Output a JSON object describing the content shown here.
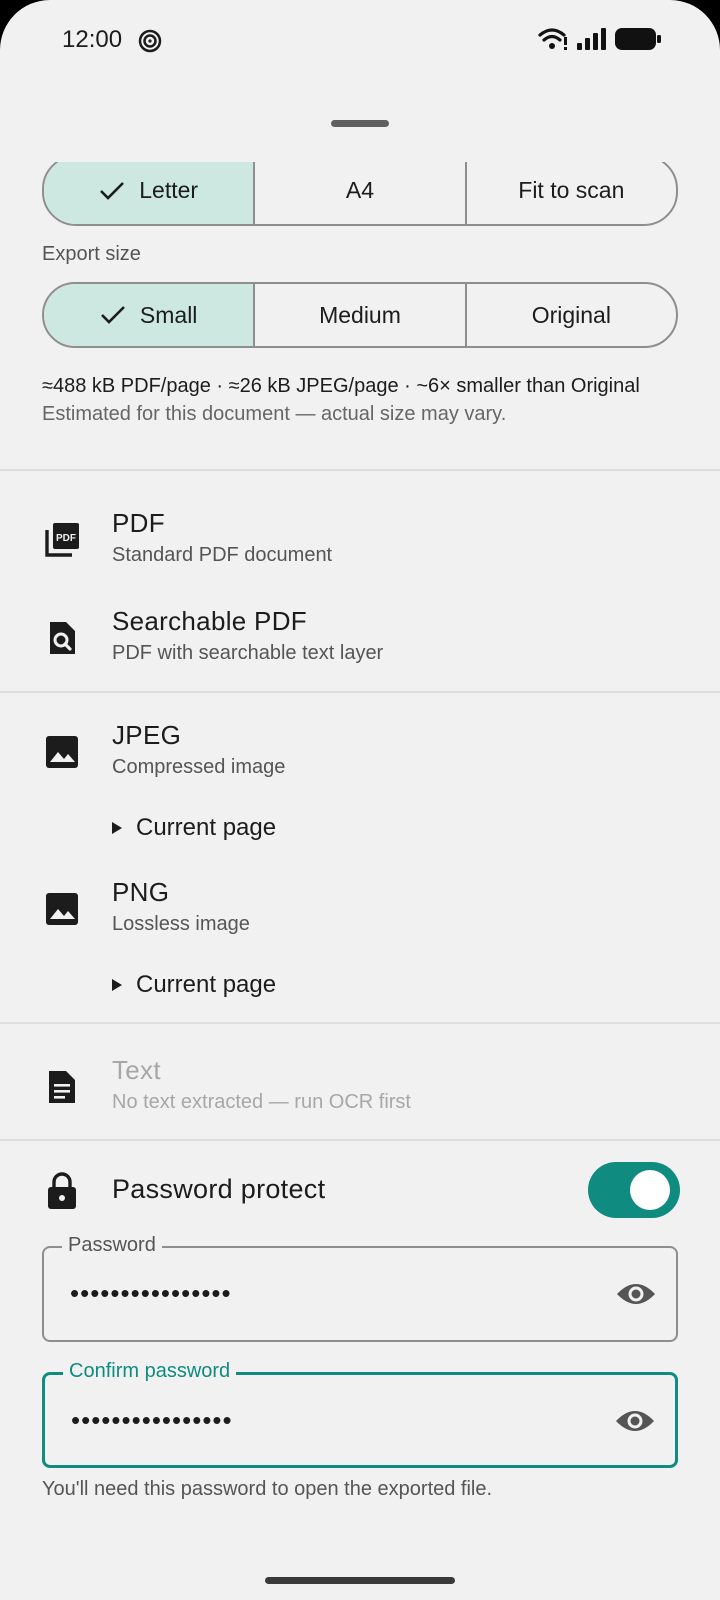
{
  "status": {
    "time": "12:00"
  },
  "page_size": {
    "options": [
      {
        "label": "Letter",
        "selected": true
      },
      {
        "label": "A4",
        "selected": false
      },
      {
        "label": "Fit to scan",
        "selected": false
      }
    ]
  },
  "export_size": {
    "label": "Export size",
    "options": [
      {
        "label": "Small",
        "selected": true
      },
      {
        "label": "Medium",
        "selected": false
      },
      {
        "label": "Original",
        "selected": false
      }
    ],
    "estimate": "≈488 kB PDF/page · ≈26 kB JPEG/page · ~6× smaller than Original",
    "note": "Estimated for this document — actual size may vary."
  },
  "formats": [
    {
      "title": "PDF",
      "subtitle": "Standard PDF document",
      "icon": "pdf-icon"
    },
    {
      "title": "Searchable PDF",
      "subtitle": "PDF with searchable text layer",
      "icon": "search-document-icon"
    },
    {
      "title": "JPEG",
      "subtitle": "Compressed image",
      "icon": "image-icon",
      "scope": "Current page"
    },
    {
      "title": "PNG",
      "subtitle": "Lossless image",
      "icon": "image-icon",
      "scope": "Current page"
    },
    {
      "title": "Text",
      "subtitle": "No text extracted — run OCR first",
      "icon": "document-text-icon",
      "disabled": true
    }
  ],
  "password": {
    "toggle_label": "Password protect",
    "enabled": true,
    "password_label": "Password",
    "password_value": "••••••••••••••••",
    "confirm_label": "Confirm password",
    "confirm_value": "••••••••••••••••",
    "hint": "You'll need this password to open the exported file."
  },
  "colors": {
    "accent": "#0f8b7f",
    "selected_segment": "#cce8e1",
    "background": "#f1f1f1"
  }
}
